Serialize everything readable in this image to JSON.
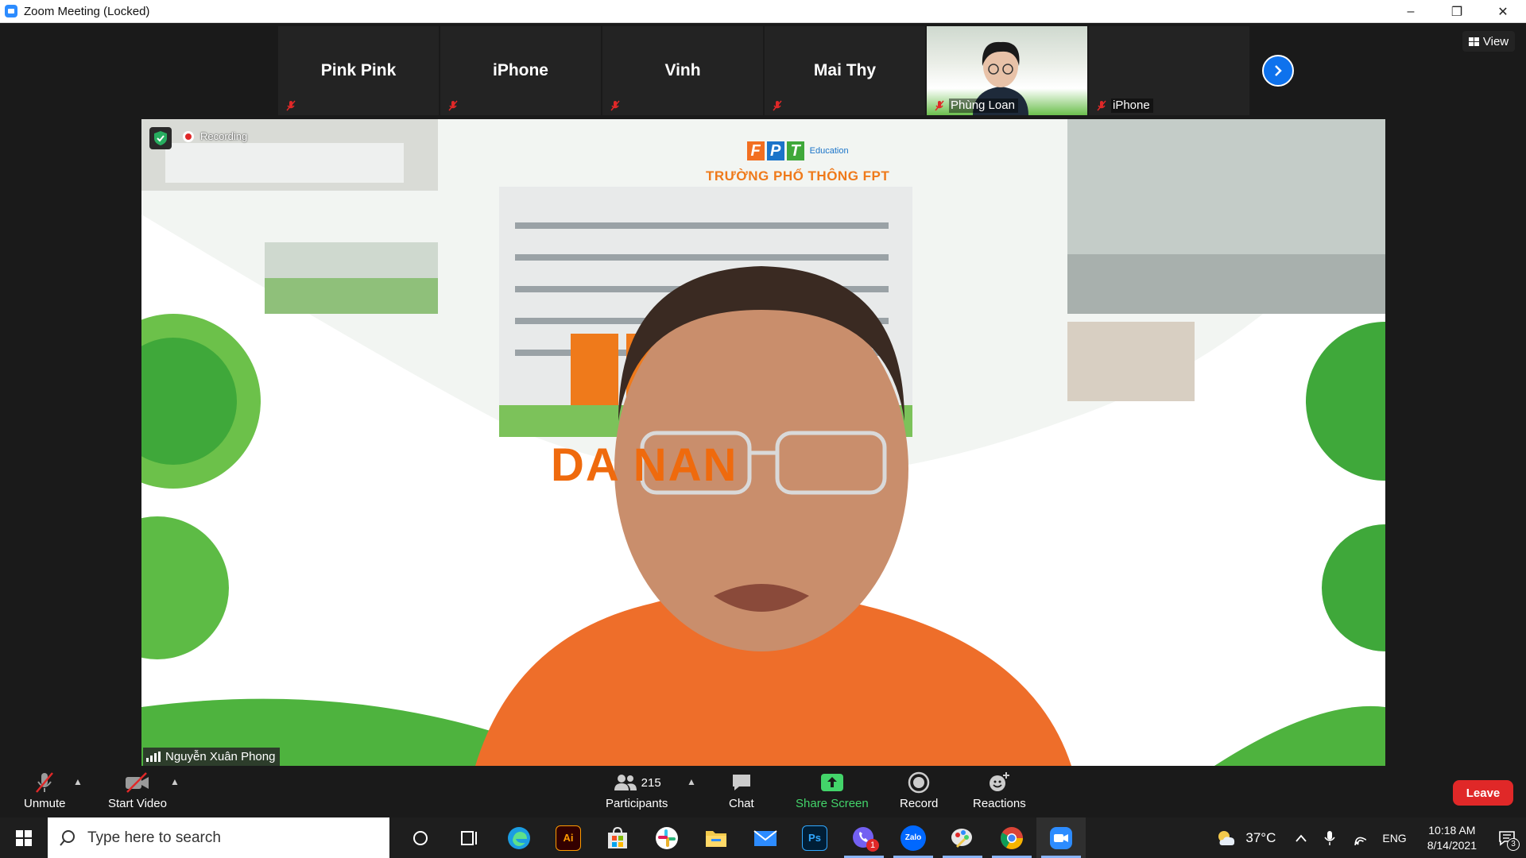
{
  "window": {
    "title": "Zoom Meeting (Locked)",
    "minimize": "–",
    "restore": "❐",
    "close": "✕"
  },
  "strip": {
    "tiles": [
      {
        "name": "Pink Pink"
      },
      {
        "name": "iPhone"
      },
      {
        "name": "Vinh"
      },
      {
        "name": "Mai Thy"
      }
    ],
    "video_tiles": [
      {
        "label": "Phùng Loan"
      },
      {
        "label": "iPhone"
      }
    ],
    "view_label": "View"
  },
  "main": {
    "recording_label": "Recording",
    "speaker_name": "Nguyễn Xuân Phong",
    "slide": {
      "logo_letters": [
        "F",
        "P",
        "T"
      ],
      "logo_sub": "Education",
      "school": "TRƯỜNG PHỔ THÔNG FPT",
      "city": "DA NAN"
    }
  },
  "toolbar": {
    "unmute": "Unmute",
    "start_video": "Start Video",
    "participants": "Participants",
    "participant_count": "215",
    "chat": "Chat",
    "share_screen": "Share Screen",
    "record": "Record",
    "reactions": "Reactions",
    "leave": "Leave"
  },
  "taskbar": {
    "search_placeholder": "Type here to search",
    "ai_label": "Ai",
    "ps_label": "Ps",
    "zalo_label": "Zalo",
    "viber_badge": "1",
    "temperature": "37°C",
    "language": "ENG",
    "time": "10:18 AM",
    "date": "8/14/2021",
    "notifications": "3"
  },
  "colors": {
    "accent": "#0e72ed",
    "leave": "#e02828",
    "share_green": "#43d46a",
    "fpt_orange": "#ef6a0d"
  }
}
